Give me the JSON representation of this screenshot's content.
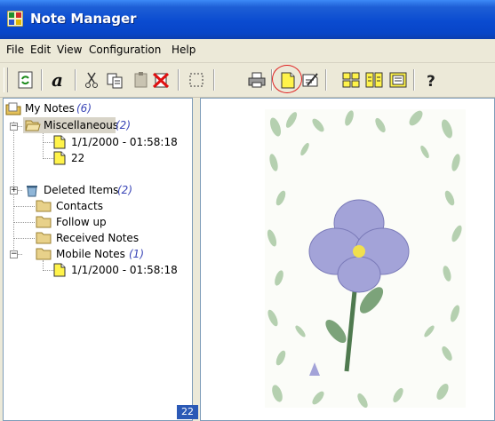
{
  "window": {
    "title": "Note Manager"
  },
  "menu": {
    "file": "File",
    "edit": "Edit",
    "view": "View",
    "configuration": "Configuration",
    "help": "Help"
  },
  "toolbar": {
    "buttons": [
      "refresh-icon",
      "font-icon",
      "cut-icon",
      "copy-icon",
      "paste-icon",
      "delete-icon",
      "select-icon",
      "print-icon",
      "new-note-icon",
      "edit-note-icon",
      "tile-icon",
      "cascade-icon",
      "single-view-icon",
      "help-icon"
    ]
  },
  "tree": {
    "root": {
      "label": "My Notes",
      "count": "(6)"
    },
    "items": [
      {
        "label": "Miscellaneous",
        "count": "(2)"
      },
      {
        "label": "1/1/2000 - 01:58:18"
      },
      {
        "label": "22"
      },
      {
        "label": "Deleted Items",
        "count": "(2)"
      },
      {
        "label": "Contacts"
      },
      {
        "label": "Follow up"
      },
      {
        "label": "Received Notes"
      },
      {
        "label": "Mobile Notes",
        "count": "(1)"
      },
      {
        "label": "1/1/2000 - 01:58:18"
      }
    ]
  },
  "preview": {
    "caption": "22"
  },
  "colors": {
    "title_bar": "#0a4bd0",
    "count_text": "#3a46b7",
    "highlight_ring": "#e02020"
  }
}
